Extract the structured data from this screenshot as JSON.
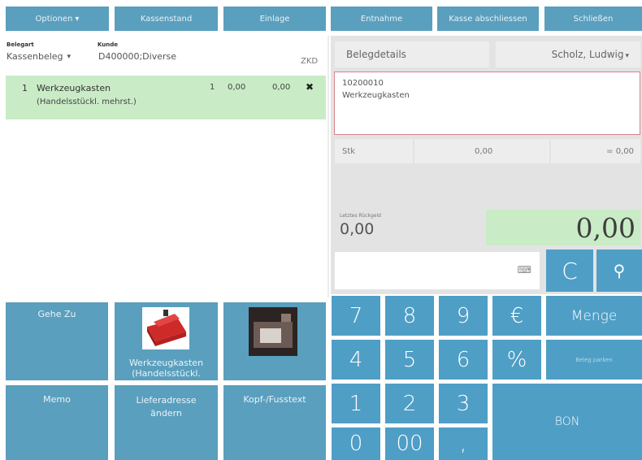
{
  "toolbar": {
    "options": "Optionen",
    "cash_status": "Kassenstand",
    "deposit": "Einlage",
    "withdrawal": "Entnahme",
    "close_register": "Kasse abschliessen",
    "close": "Schließen"
  },
  "receipt_header": {
    "type_label": "Belegart",
    "type_value": "Kassenbeleg",
    "customer_label": "Kunde",
    "customer_value": "D400000;Diverse",
    "zkd": "ZKD"
  },
  "line_items": [
    {
      "pos": "1",
      "name": "Werkzeugkasten",
      "sub": "(Handelsstückl. mehrst.)",
      "qty": "1",
      "price": "0,00",
      "total": "0,00"
    }
  ],
  "details": {
    "tab": "Belegdetails",
    "user": "Scholz, Ludwig",
    "article_no": "10200010",
    "article_name": "Werkzeugkasten",
    "unit": "Stk",
    "amount": "0,00",
    "sum": "= 0,00"
  },
  "totals": {
    "last_change_label": "Letztes Rückgeld",
    "last_change": "0,00",
    "total": "0,00"
  },
  "tiles": {
    "goto": "Gehe Zu",
    "toolbox": "Werkzeugkasten (Handelsstückl.",
    "memo": "Memo",
    "change_address": "Lieferadresse ändern",
    "header_footer": "Kopf-/Fusstext"
  },
  "keypad": {
    "k7": "7",
    "k8": "8",
    "k9": "9",
    "euro": "€",
    "quantity": "Menge",
    "k4": "4",
    "k5": "5",
    "k6": "6",
    "percent": "%",
    "park": "Beleg parken",
    "k1": "1",
    "k2": "2",
    "k3": "3",
    "bon": "BON",
    "k0": "0",
    "k00": "00",
    "comma": ",",
    "clear": "C"
  },
  "icons": {
    "caret": "caret-down-icon",
    "delete": "close-x-icon",
    "keyboard": "keyboard-icon",
    "search": "search-icon"
  }
}
